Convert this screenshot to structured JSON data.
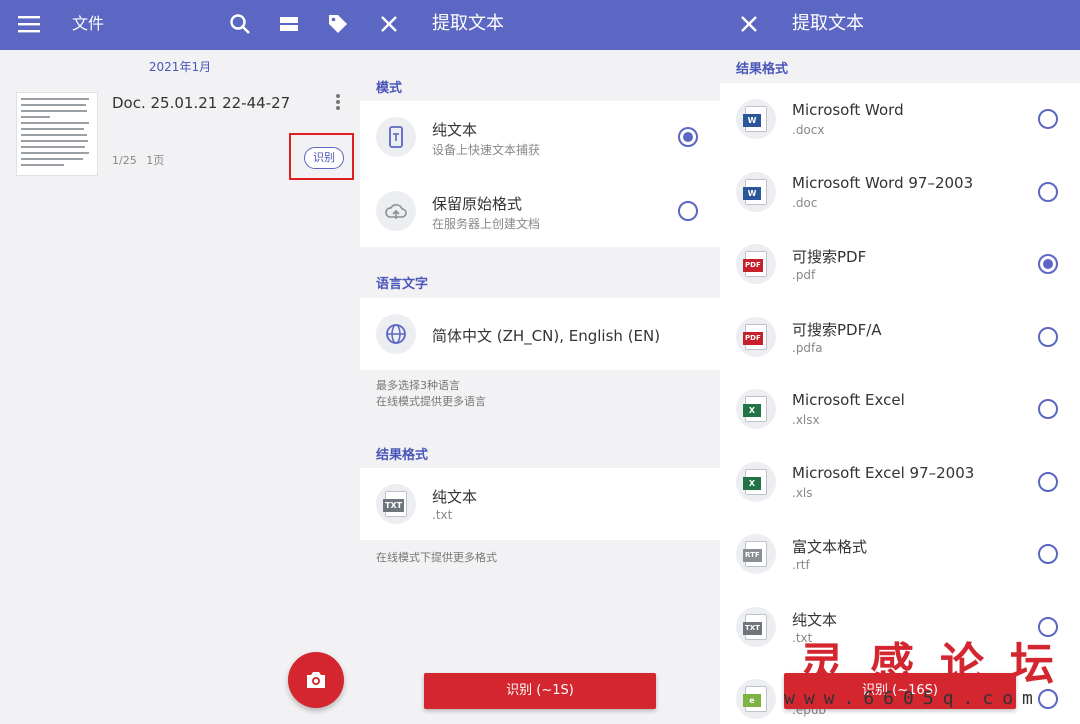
{
  "files_screen": {
    "title": "文件",
    "date_header": "2021年1月",
    "document": {
      "name": "Doc. 25.01.21 22-44-27",
      "pages": "1/25",
      "page_count": "1页",
      "ocr_button": "识别"
    },
    "icons": [
      "menu-icon",
      "search-icon",
      "view-icon",
      "tag-icon",
      "camera-icon"
    ]
  },
  "extract_screen": {
    "title": "提取文本",
    "mode_header": "模式",
    "modes": [
      {
        "label": "纯文本",
        "sub": "设备上快速文本捕获",
        "selected": true,
        "icon": "phone-text-icon"
      },
      {
        "label": "保留原始格式",
        "sub": "在服务器上创建文档",
        "selected": false,
        "icon": "cloud-icon"
      }
    ],
    "language_header": "语言文字",
    "language": "简体中文 (ZH_CN), English (EN)",
    "language_hint_1": "最多选择3种语言",
    "language_hint_2": "在线模式提供更多语言",
    "format_header": "结果格式",
    "format": {
      "label": "纯文本",
      "ext": ".txt"
    },
    "format_hint": "在线模式下提供更多格式",
    "recognize_button": "识别 (~1S)"
  },
  "format_screen": {
    "title": "提取文本",
    "header": "结果格式",
    "formats": [
      {
        "label": "Microsoft Word",
        "ext": ".docx",
        "tag": "W",
        "color": "#2b579a",
        "selected": false
      },
      {
        "label": "Microsoft Word 97–2003",
        "ext": ".doc",
        "tag": "W",
        "color": "#2b579a",
        "selected": false
      },
      {
        "label": "可搜索PDF",
        "ext": ".pdf",
        "tag": "PDF",
        "color": "#c8202b",
        "selected": true
      },
      {
        "label": "可搜索PDF/A",
        "ext": ".pdfa",
        "tag": "PDF",
        "color": "#c8202b",
        "selected": false
      },
      {
        "label": "Microsoft Excel",
        "ext": ".xlsx",
        "tag": "X",
        "color": "#217346",
        "selected": false
      },
      {
        "label": "Microsoft Excel 97–2003",
        "ext": ".xls",
        "tag": "X",
        "color": "#217346",
        "selected": false
      },
      {
        "label": "富文本格式",
        "ext": ".rtf",
        "tag": "RTF",
        "color": "#8a8f96",
        "selected": false
      },
      {
        "label": "纯文本",
        "ext": ".txt",
        "tag": "TXT",
        "color": "#6f757c",
        "selected": false
      },
      {
        "label": "",
        "ext": ".epub",
        "tag": "e",
        "color": "#7cb342",
        "selected": false
      }
    ],
    "recognize_button": "识别 (~16S)"
  },
  "watermark": {
    "text": "灵感论坛",
    "url": "www.6605q.com"
  },
  "colors": {
    "appbar": "#5b67c3",
    "accent": "#4a56b8",
    "action": "#d3262f",
    "highlight": "#e02020"
  }
}
